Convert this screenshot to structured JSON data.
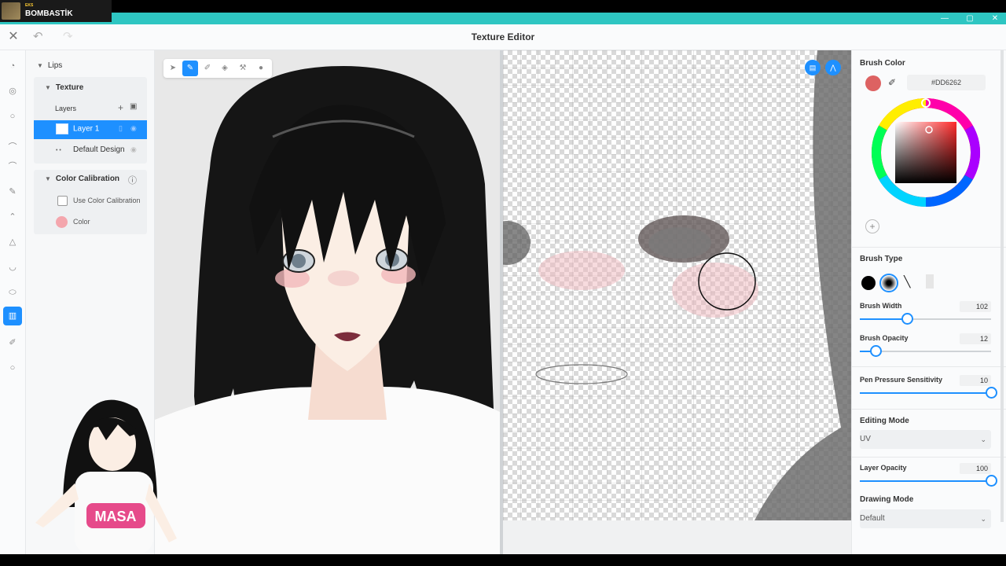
{
  "overlay": {
    "small": "EKS",
    "name": "BOMBASTİK"
  },
  "window": {
    "title": "Texture Editor",
    "minimize": "—",
    "maximize": "▢",
    "close": "✕"
  },
  "header": {
    "close_glyph": "✕",
    "undo_glyph": "↶",
    "redo_glyph": "↷"
  },
  "layers_panel": {
    "group_title": "Lips",
    "texture_title": "Texture",
    "layers_label": "Layers",
    "layers": [
      {
        "label": "Layer 1",
        "selected": true
      },
      {
        "label": "Default Design",
        "selected": false
      }
    ],
    "calibration_title": "Color Calibration",
    "use_calibration_label": "Use Color Calibration",
    "color_label": "Color"
  },
  "brush": {
    "color_title": "Brush Color",
    "hex": "#DD6262",
    "type_title": "Brush Type",
    "width_label": "Brush Width",
    "width_value": "102",
    "width_fraction": 0.36,
    "opacity_label": "Brush Opacity",
    "opacity_value": "12",
    "opacity_fraction": 0.12,
    "pressure_label": "Pen Pressure Sensitivity",
    "pressure_value": "10",
    "pressure_fraction": 1.0
  },
  "editing_mode": {
    "title": "Editing Mode",
    "value": "UV"
  },
  "layer_opacity": {
    "label": "Layer Opacity",
    "value": "100",
    "fraction": 1.0
  },
  "drawing_mode": {
    "title": "Drawing Mode",
    "value": "Default"
  },
  "colors": {
    "accent": "#1e90ff",
    "brush": "#dd6262",
    "teal": "#2ec6c2"
  }
}
